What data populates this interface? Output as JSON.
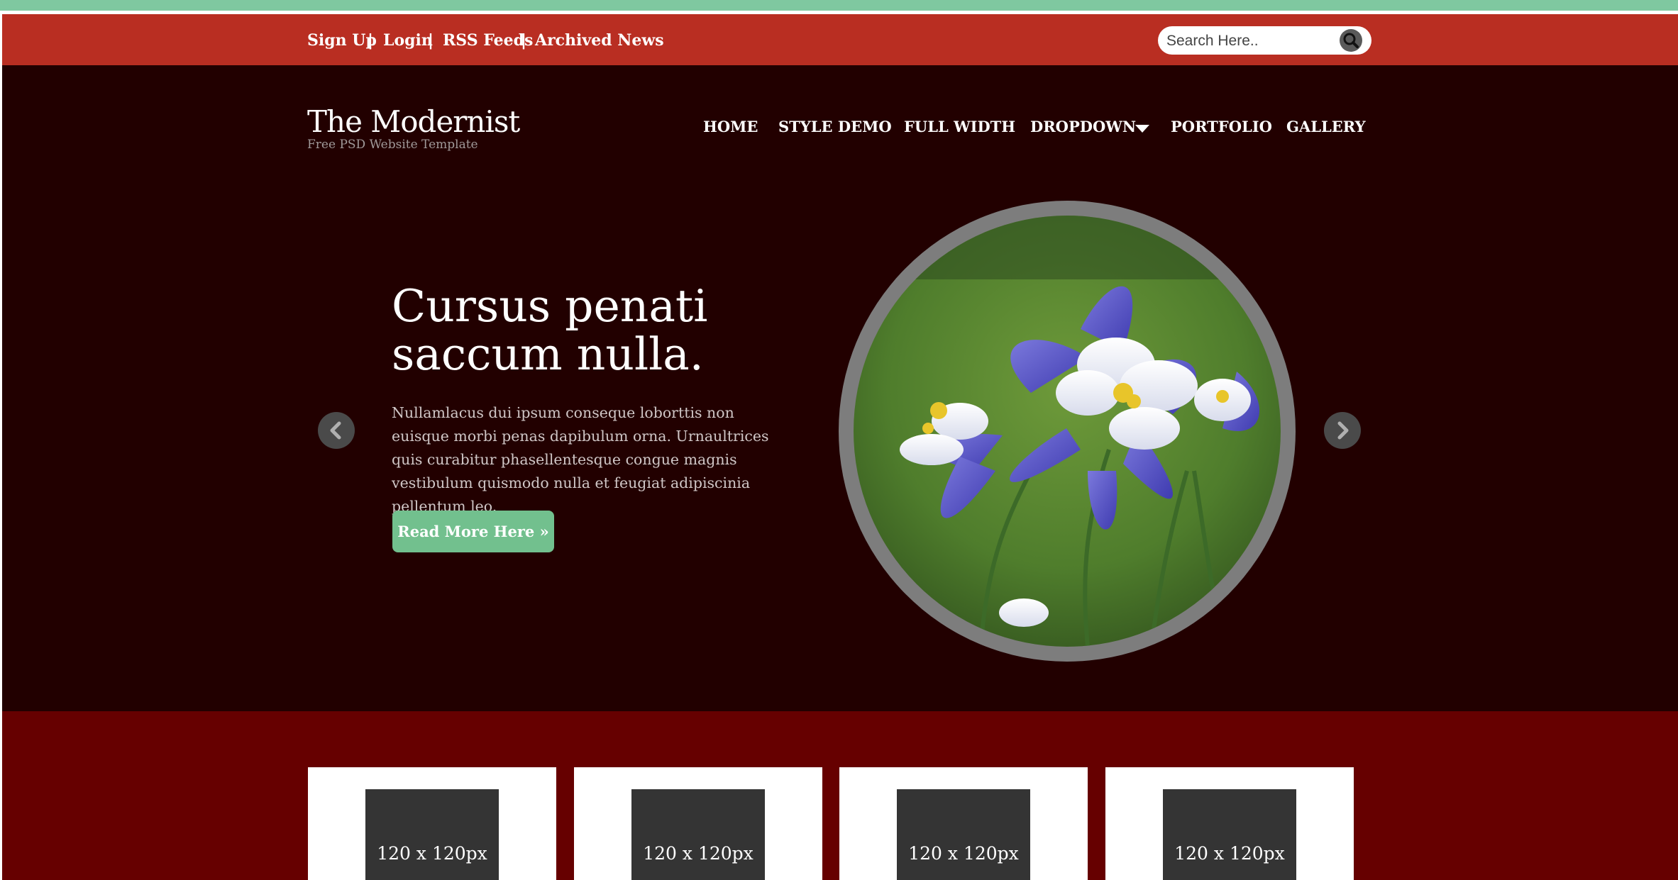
{
  "topbar": {
    "links": [
      "Sign Up",
      "Login",
      "RSS Feeds",
      "Archived News"
    ],
    "separator": "|",
    "search_placeholder": "Search Here..",
    "search_icon": "magnifier-icon"
  },
  "brand": {
    "title": "The Modernist",
    "subtitle": "Free PSD Website Template"
  },
  "nav": {
    "items": [
      "HOME",
      "STYLE DEMO",
      "FULL WIDTH",
      "DROPDOWN",
      "PORTFOLIO",
      "GALLERY"
    ],
    "dropdown_icon": "caret-down-icon"
  },
  "hero": {
    "heading_line1": "Cursus penati",
    "heading_line2": "saccum nulla.",
    "body": "Nullamlacus dui ipsum conseque loborttis non euisque morbi penas dapibulum orna. Urnaultrices quis curabitur phasellentesque congue magnis vestibulum quismodo nulla et feugiat adipiscinia pellentum leo.",
    "button_label": "Read More Here »",
    "prev_icon": "chevron-left-icon",
    "next_icon": "chevron-right-icon",
    "image": "columbine-flower-photo"
  },
  "thumbs": {
    "labels": [
      "120 x 120px",
      "120 x 120px",
      "120 x 120px",
      "120 x 120px"
    ]
  },
  "colors": {
    "top_bar": "#b92e22",
    "accent_strip": "#7fc8a0",
    "hero_bg": "#220000",
    "lower_band": "#660000",
    "button": "#72c08e"
  }
}
